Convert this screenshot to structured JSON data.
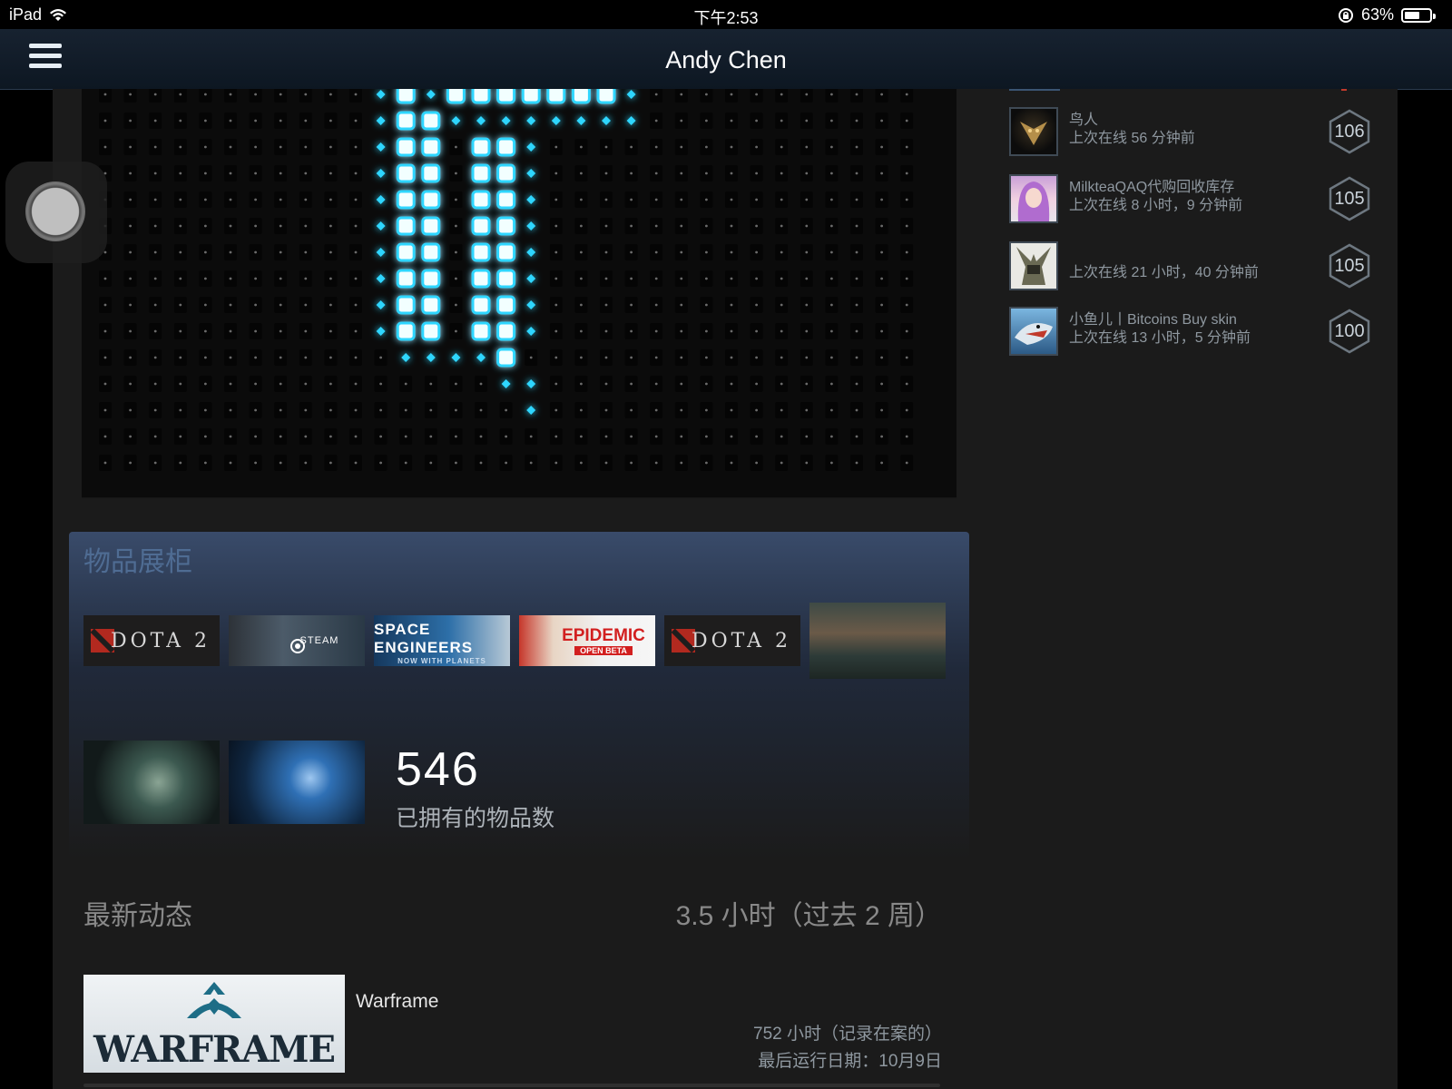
{
  "status_bar": {
    "device": "iPad",
    "time": "下午2:53",
    "battery": "63%",
    "battery_level": 0.63
  },
  "nav": {
    "title": "Andy Chen"
  },
  "showcase": {
    "title": "物品展柜",
    "tiles": [
      {
        "name": "DOTA 2"
      },
      {
        "name": "STEAM"
      },
      {
        "name": "SPACE ENGINEERS",
        "sub": "NOW WITH PLANETS"
      },
      {
        "name": "EPIDEMIC",
        "sub": "OPEN BETA"
      },
      {
        "name": "DOTA 2"
      }
    ],
    "item_count": "546",
    "item_count_label": "已拥有的物品数"
  },
  "recent": {
    "title": "最新动态",
    "hours": "3.5 小时（过去 2 周）",
    "game": {
      "image_text": "WARFRAME",
      "name": "Warframe",
      "hours_on_record": "752 小时（记录在案的）",
      "last_played": "最后运行日期：10月9日"
    }
  },
  "friends": [
    {
      "name": "鸟人",
      "status": "上次在线 56 分钟前",
      "level": "106"
    },
    {
      "name": "MilkteaQAQ代购回收库存",
      "status": "上次在线 8 小时，9 分钟前",
      "level": "105"
    },
    {
      "name": "",
      "status": "上次在线 21 小时，40 分钟前",
      "level": "105"
    },
    {
      "name": "小鱼儿丨Bitcoins Buy skin",
      "status": "上次在线 13 小时，5 分钟前",
      "level": "100"
    }
  ],
  "colors": {
    "accent": "#2fd6ff",
    "showcase_title": "#4f6c93",
    "panel": "#1b1b1b"
  }
}
